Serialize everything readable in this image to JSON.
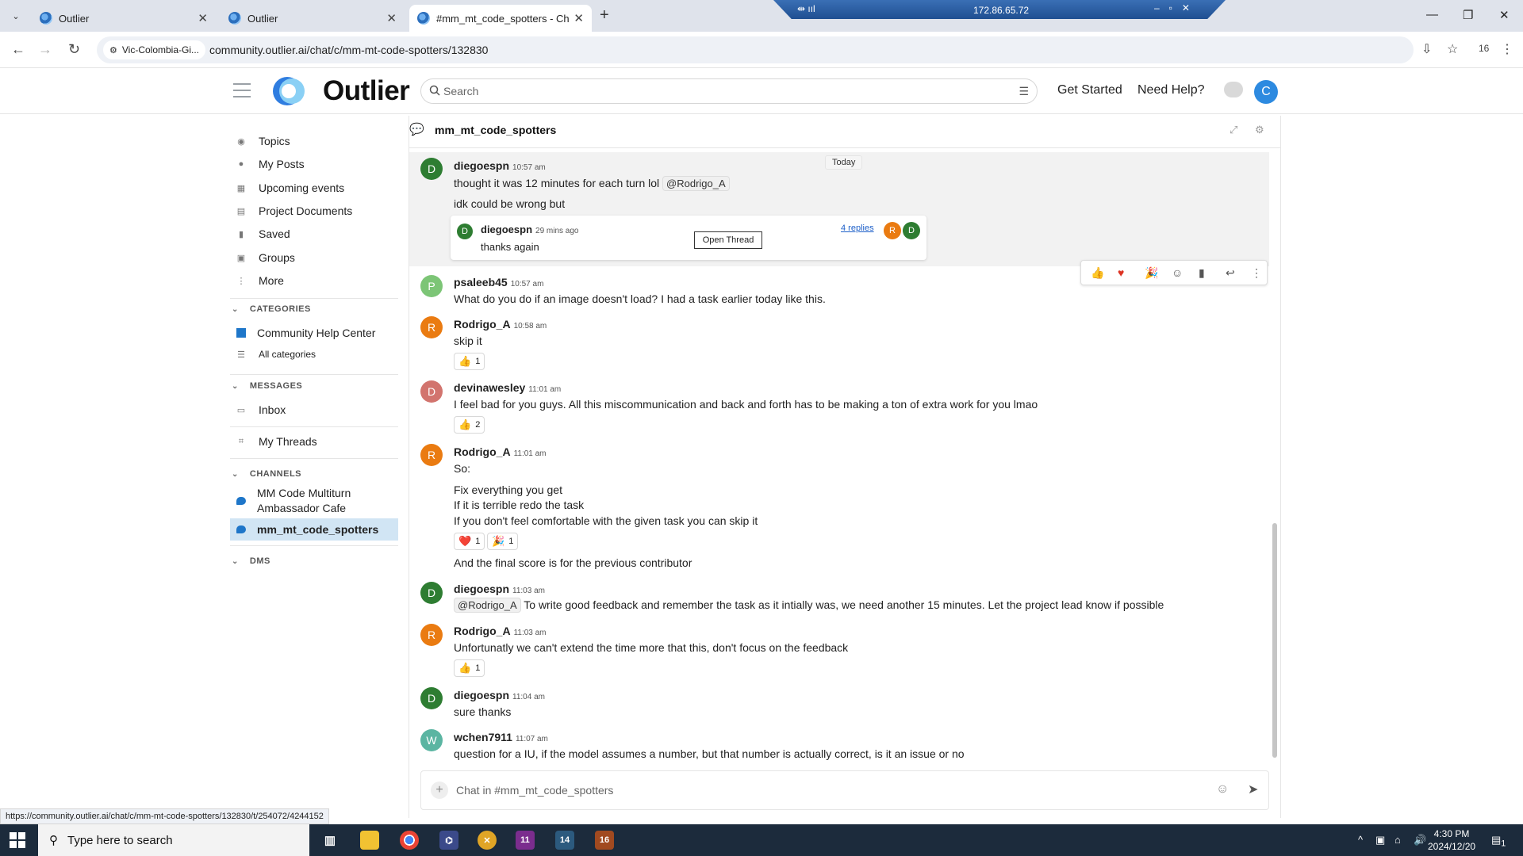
{
  "browser": {
    "tabs": [
      {
        "label": "Outlier",
        "active": false
      },
      {
        "label": "Outlier",
        "active": false
      },
      {
        "label": "#mm_mt_code_spotters - Chat",
        "active": true
      }
    ],
    "remote_ip": "172.86.65.72",
    "site_chip": "Vic-Colombia-Gi...",
    "url": "community.outlier.ai/chat/c/mm-mt-code-spotters/132830",
    "profile_count": "16",
    "status_url": "https://community.outlier.ai/chat/c/mm-mt-code-spotters/132830/t/254072/4244152"
  },
  "header": {
    "logo": "Outlier",
    "search_placeholder": "Search",
    "get_started": "Get Started",
    "need_help": "Need Help?",
    "avatar_letter": "C"
  },
  "sidebar": {
    "items": [
      "Topics",
      "My Posts",
      "Upcoming events",
      "Project Documents",
      "Saved",
      "Groups",
      "More"
    ],
    "categories_label": "CATEGORIES",
    "categories": [
      "Community Help Center",
      "All categories"
    ],
    "messages_label": "MESSAGES",
    "messages": [
      "Inbox",
      "My Threads"
    ],
    "channels_label": "CHANNELS",
    "channels": [
      "MM Code Multiturn Ambassador Cafe",
      "mm_mt_code_spotters"
    ],
    "dms_label": "DMS"
  },
  "chat": {
    "title": "mm_mt_code_spotters",
    "today_label": "Today",
    "composer_placeholder": "Chat in #mm_mt_code_spotters",
    "thread": {
      "user": "diegoespn",
      "time": "29 mins ago",
      "text": "thanks again",
      "open_label": "Open Thread",
      "replies": "4 replies",
      "participants": [
        "R",
        "D"
      ]
    },
    "messages": [
      {
        "user": "diegoespn",
        "time": "10:57 am",
        "avatar": "D",
        "color": "#2e7d32",
        "line1_pre": "thought it was 12 minutes for each turn lol",
        "line1_mention": "@Rodrigo_A",
        "line2": "idk could be wrong but"
      },
      {
        "user": "psaleeb45",
        "time": "10:57 am",
        "avatar": "P",
        "color": "#7cc576",
        "text": "What do you do if an image doesn't load? I had a task earlier today like this."
      },
      {
        "user": "Rodrigo_A",
        "time": "10:58 am",
        "avatar": "R",
        "color": "#ea7b11",
        "text": "skip it",
        "reaction": {
          "emoji": "👍",
          "count": "1"
        }
      },
      {
        "user": "devinawesley",
        "time": "11:01 am",
        "avatar": "D",
        "color": "#d2746e",
        "text": "I feel bad for you guys. All this miscommunication and back and forth has to be making a ton of extra work for you lmao",
        "reaction": {
          "emoji": "👍",
          "count": "2"
        }
      },
      {
        "user": "Rodrigo_A",
        "time": "11:01 am",
        "avatar": "R",
        "color": "#ea7b11",
        "lines": [
          "So:",
          "Fix everything you get",
          "If it is terrible redo the task",
          "If you don't feel comfortable with the given task you can skip it"
        ],
        "reactions": [
          {
            "emoji": "❤️",
            "count": "1"
          },
          {
            "emoji": "🎉",
            "count": "1"
          }
        ],
        "after": "And the final score is for the previous contributor"
      },
      {
        "user": "diegoespn",
        "time": "11:03 am",
        "avatar": "D",
        "color": "#2e7d32",
        "mention": "@Rodrigo_A",
        "text": "To write good feedback and remember the task as it intially was, we need another 15 minutes. Let the project lead know if possible"
      },
      {
        "user": "Rodrigo_A",
        "time": "11:03 am",
        "avatar": "R",
        "color": "#ea7b11",
        "text": "Unfortunatly we can't extend the time more that this, don't focus on the feedback",
        "reaction": {
          "emoji": "👍",
          "count": "1"
        }
      },
      {
        "user": "diegoespn",
        "time": "11:04 am",
        "avatar": "D",
        "color": "#2e7d32",
        "text": "sure thanks"
      },
      {
        "user": "wchen7911",
        "time": "11:07 am",
        "avatar": "W",
        "color": "#5bb5a2",
        "text": "question for a IU, if the model assumes a number, but that number is actually correct, is it an issue or no"
      }
    ]
  },
  "taskbar": {
    "search_placeholder": "Type here to search",
    "time": "4:30 PM",
    "date": "2024/12/20",
    "badges": [
      "11",
      "14",
      "16"
    ],
    "notification_count": "1"
  }
}
